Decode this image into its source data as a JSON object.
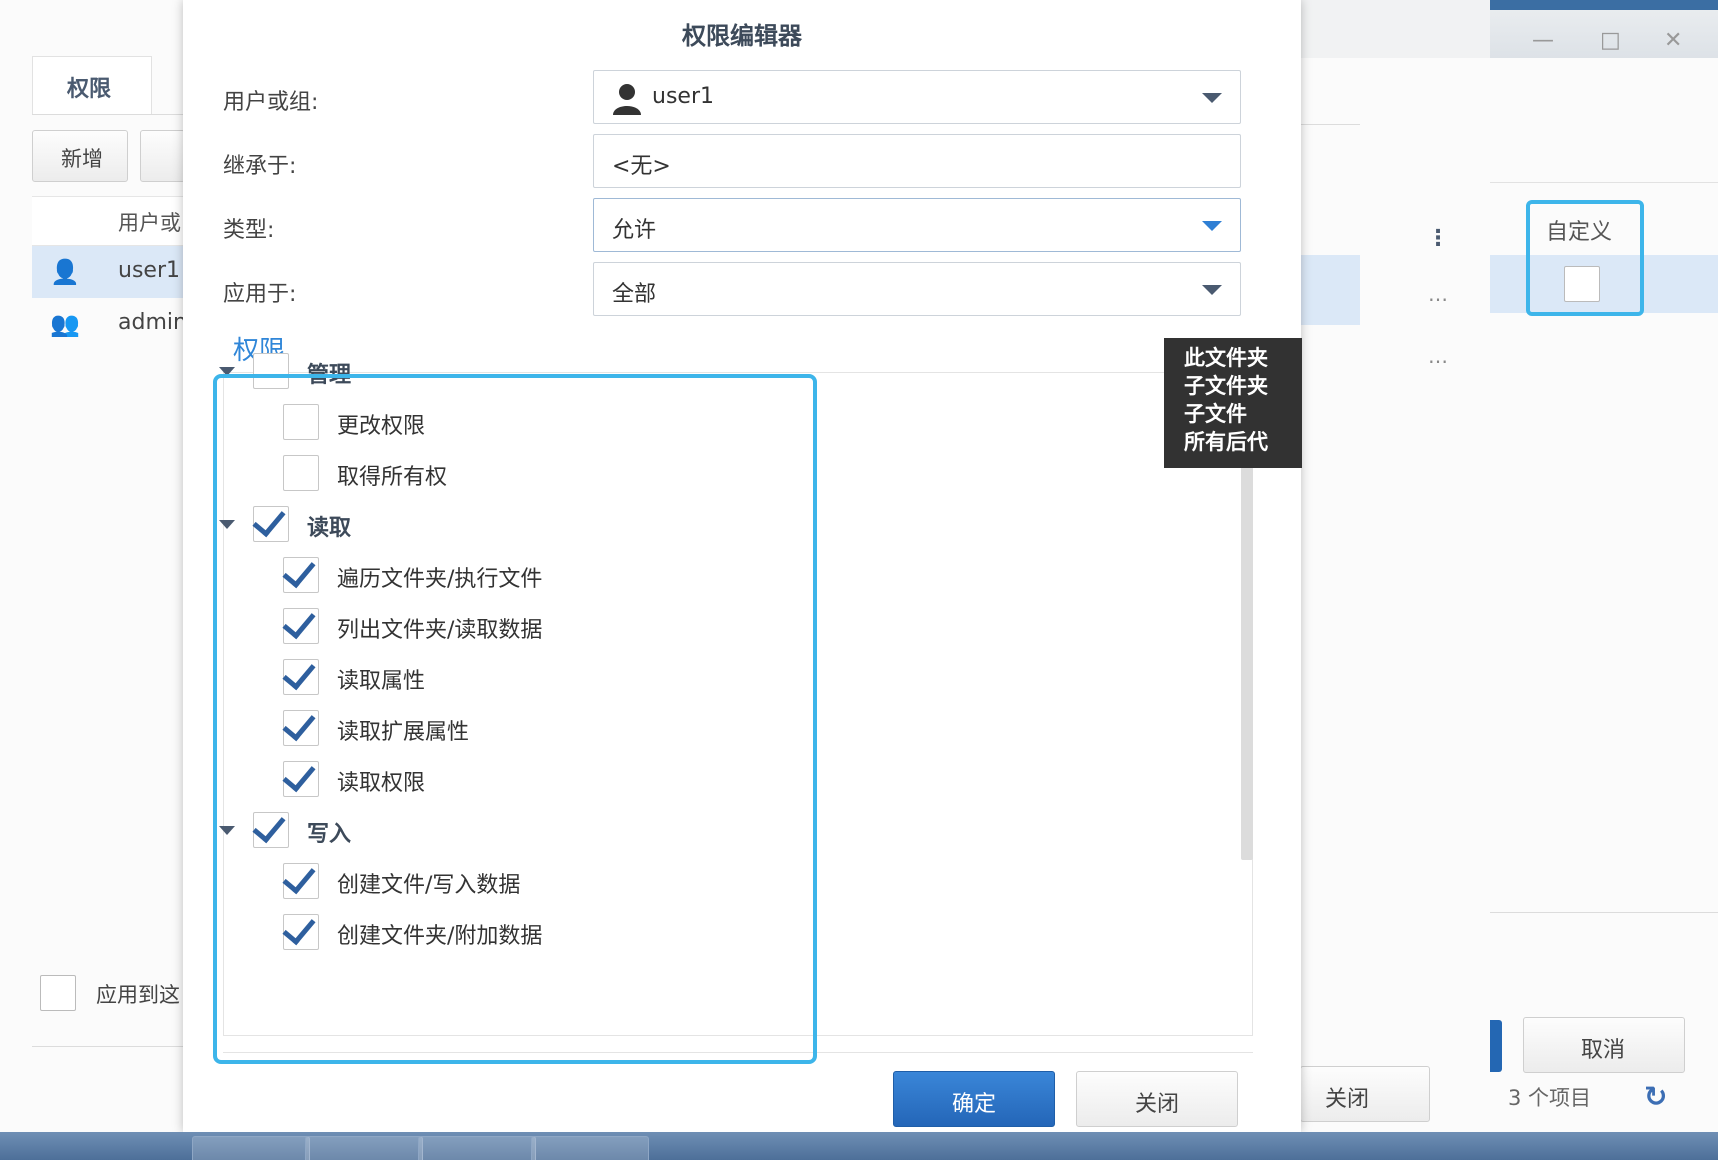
{
  "background_left": {
    "tab_label": "权限",
    "add_button": "新增",
    "column_header": "用户或",
    "rows": [
      {
        "name": "user1",
        "icon": "user-icon"
      },
      {
        "name": "admin",
        "icon": "group-icon"
      }
    ],
    "apply_label": "应用到这"
  },
  "background_right": {
    "custom_column": "自定义",
    "cancel_label": "取消",
    "close_label": "关闭",
    "item_count": "3 个项目"
  },
  "dialog": {
    "title": "权限编辑器",
    "fields": {
      "user_label": "用户或组:",
      "user_value": "user1",
      "inherit_label": "继承于:",
      "inherit_value": "<无>",
      "type_label": "类型:",
      "type_value": "允许",
      "apply_label": "应用于:",
      "apply_value": "全部"
    },
    "permissions_heading": "权限",
    "permissions": [
      {
        "label": "管理",
        "level": 0,
        "checked": false,
        "expanded": true
      },
      {
        "label": "更改权限",
        "level": 1,
        "checked": false
      },
      {
        "label": "取得所有权",
        "level": 1,
        "checked": false
      },
      {
        "label": "读取",
        "level": 0,
        "checked": true,
        "expanded": true
      },
      {
        "label": "遍历文件夹/执行文件",
        "level": 1,
        "checked": true
      },
      {
        "label": "列出文件夹/读取数据",
        "level": 1,
        "checked": true
      },
      {
        "label": "读取属性",
        "level": 1,
        "checked": true
      },
      {
        "label": "读取扩展属性",
        "level": 1,
        "checked": true
      },
      {
        "label": "读取权限",
        "level": 1,
        "checked": true
      },
      {
        "label": "写入",
        "level": 0,
        "checked": true,
        "expanded": true
      },
      {
        "label": "创建文件/写入数据",
        "level": 1,
        "checked": true
      },
      {
        "label": "创建文件夹/附加数据",
        "level": 1,
        "checked": true
      }
    ],
    "tooltip_lines": [
      "此文件夹",
      "子文件夹",
      "子文件",
      "所有后代"
    ],
    "ok_label": "确定",
    "close_label": "关闭"
  },
  "colors": {
    "accent": "#3db5ea",
    "primary_button": "#2466b8",
    "check": "#2e5f9e",
    "heading": "#2f86d8"
  }
}
